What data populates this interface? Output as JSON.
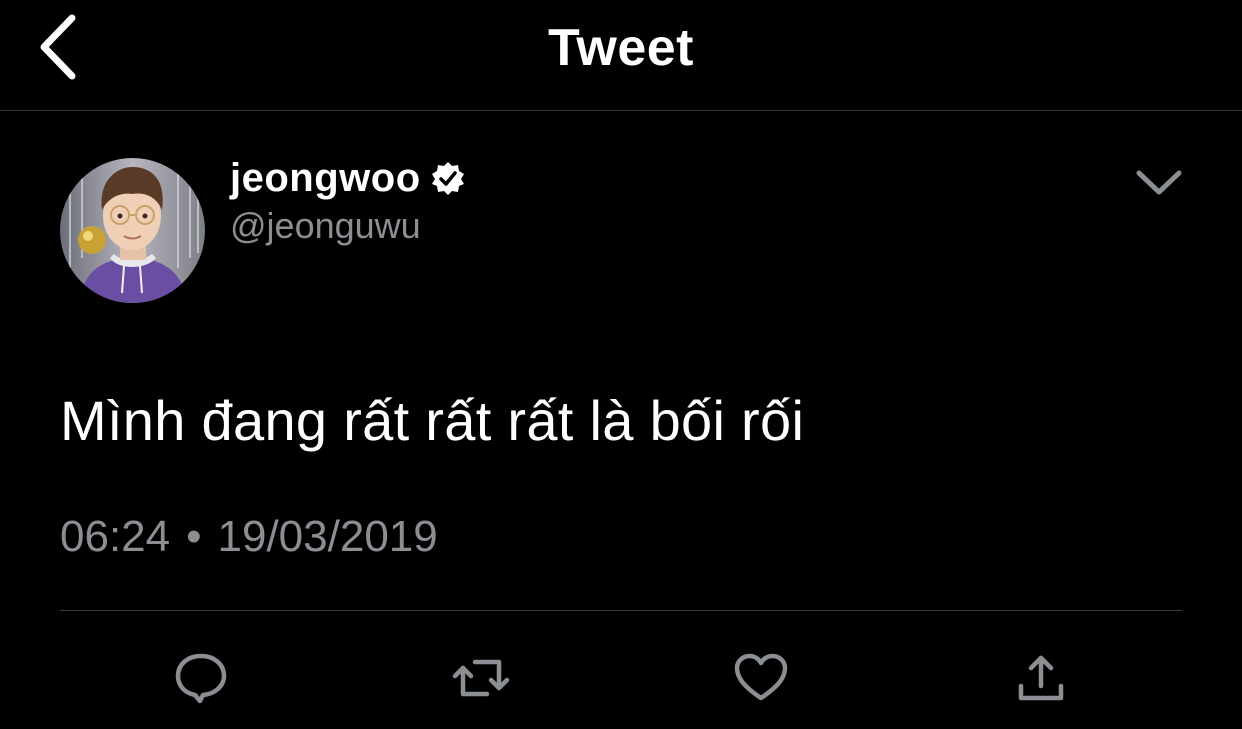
{
  "header": {
    "title": "Tweet",
    "back_icon": "chevron-left-icon"
  },
  "author": {
    "display_name": "jeongwoo",
    "handle": "@jeonguwu",
    "verified": true,
    "avatar": "avatar-photo"
  },
  "tweet": {
    "text": "Mình đang rất rất rất là bối rối",
    "time": "06:24",
    "separator": "•",
    "date": "19/03/2019"
  },
  "actions": [
    {
      "name": "reply",
      "icon": "reply-icon"
    },
    {
      "name": "retweet",
      "icon": "retweet-icon"
    },
    {
      "name": "like",
      "icon": "heart-icon"
    },
    {
      "name": "share",
      "icon": "share-icon"
    }
  ],
  "colors": {
    "background": "#000000",
    "text": "#ffffff",
    "secondary_text": "#8b8f93",
    "icon": "#8b8f93",
    "divider": "#3a3d40"
  }
}
